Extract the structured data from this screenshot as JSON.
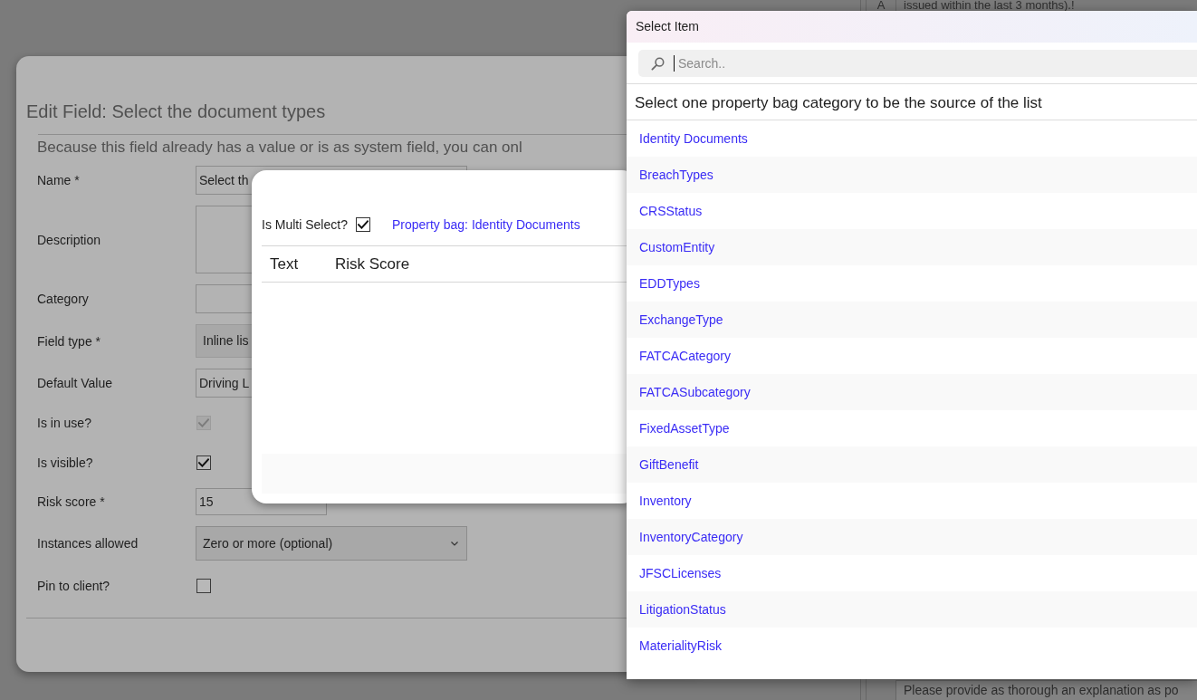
{
  "background_table": {
    "top_row": {
      "column_1": "A",
      "column_2": "issued within the last 3 months).!"
    },
    "bottom_row": {
      "column_2": "Please provide as thorough an explanation as po"
    }
  },
  "edit_field_dialog": {
    "title": "Edit Field: Select the document types",
    "notice": "Because this field already has a value or is as system field, you can onl",
    "fields": [
      {
        "kind": "text",
        "label": "Name *",
        "value": "Select th"
      },
      {
        "kind": "textarea",
        "label": "Description"
      },
      {
        "kind": "text",
        "label": "Category"
      },
      {
        "kind": "picker",
        "label": "Field type *",
        "value": "Inline lis"
      },
      {
        "kind": "text",
        "label": "Default Value",
        "value": "Driving L"
      },
      {
        "kind": "checkbox",
        "label": "Is in use?",
        "checked": true,
        "disabled": true
      },
      {
        "kind": "checkbox",
        "label": "Is visible?",
        "checked": true,
        "disabled": false
      },
      {
        "kind": "number",
        "label": "Risk score *",
        "value": "15"
      },
      {
        "kind": "select",
        "label": "Instances allowed",
        "value": "Zero or more (optional)"
      },
      {
        "kind": "checkbox",
        "label": "Pin to client?",
        "checked": false,
        "disabled": false
      }
    ]
  },
  "inline_list_dialog": {
    "multi_select": {
      "label": "Is Multi Select?",
      "checked": true
    },
    "property_bag_link": "Property bag: Identity Documents",
    "table": {
      "columns": [
        "Text",
        "Risk Score"
      ]
    }
  },
  "select_item_panel": {
    "title": "Select Item",
    "search": {
      "placeholder": "Search.."
    },
    "instruction": "Select one property bag category to be the source of the list",
    "items": [
      "Identity Documents",
      "BreachTypes",
      "CRSStatus",
      "CustomEntity",
      "EDDTypes",
      "ExchangeType",
      "FATCACategory",
      "FATCASubcategory",
      "FixedAssetType",
      "GiftBenefit",
      "Inventory",
      "InventoryCategory",
      "JFSCLicenses",
      "LitigationStatus",
      "MaterialityRisk"
    ]
  }
}
